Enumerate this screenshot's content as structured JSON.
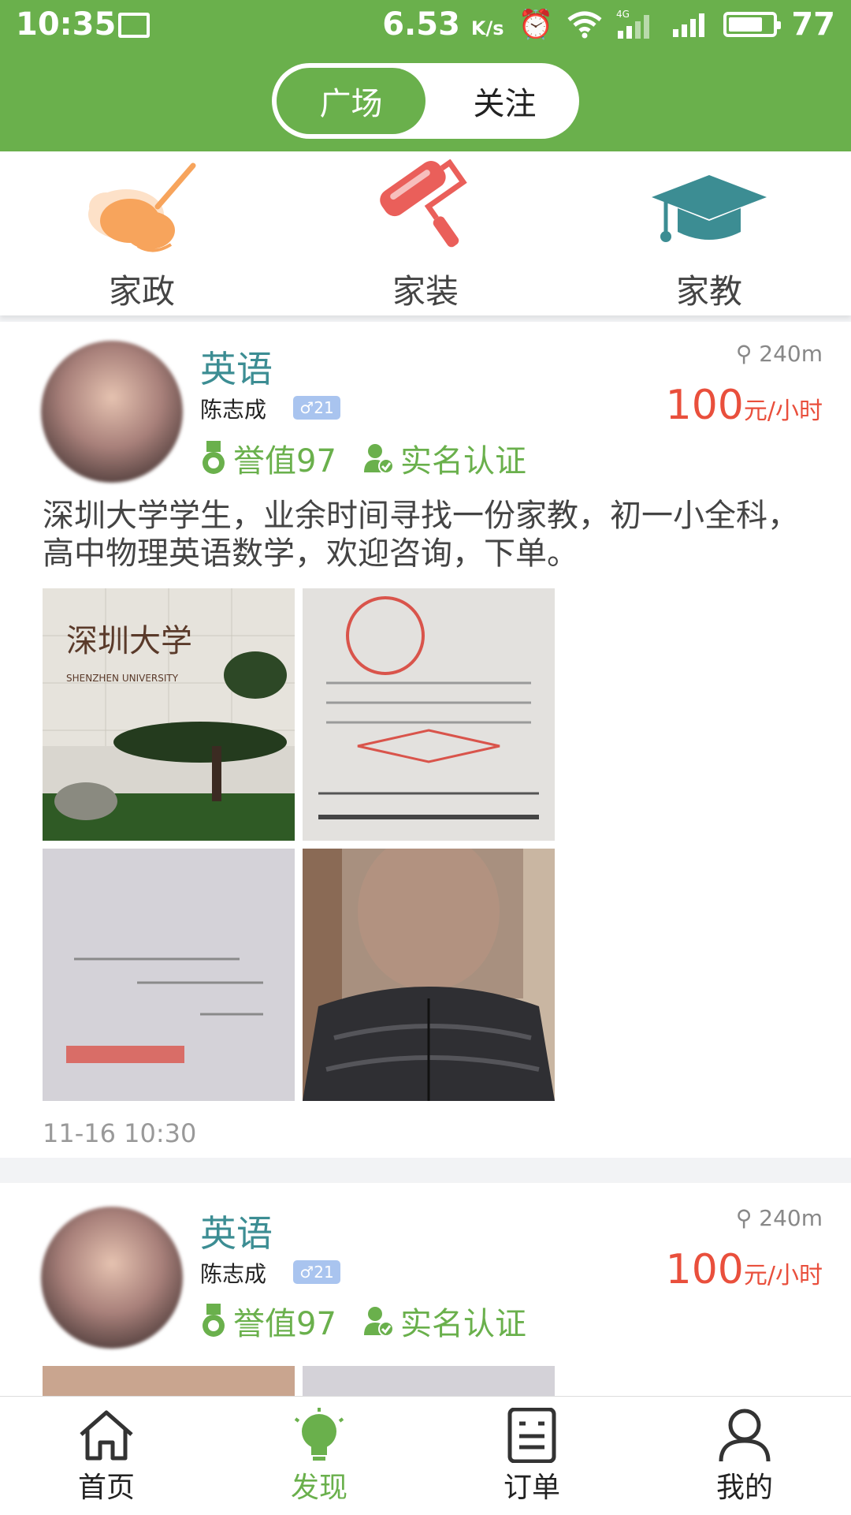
{
  "status_bar": {
    "time": "10:35",
    "net_speed": "6.53",
    "net_unit": "K/s",
    "network": "4G",
    "battery": "77"
  },
  "segment": {
    "active": "广场",
    "inactive": "关注"
  },
  "categories": [
    {
      "label": "家政",
      "icon": "broom-icon"
    },
    {
      "label": "家装",
      "icon": "paint-roller-icon"
    },
    {
      "label": "家教",
      "icon": "graduation-cap-icon"
    }
  ],
  "posts": [
    {
      "subject": "英语",
      "name": "陈志成",
      "gender_age": "♂21",
      "distance": "240m",
      "price_value": "100",
      "price_unit": "元/小时",
      "reputation": "誉值97",
      "verified": "实名认证",
      "description": "深圳大学学生，业余时间寻找一份家教，初一小全科，高中物理英语数学，欢迎咨询，下单。",
      "photo_caption_en": "SHENZHEN UNIVERSITY",
      "photo_caption_cn": "深圳大学",
      "timestamp": "11-16 10:30"
    },
    {
      "subject": "英语",
      "name": "陈志成",
      "gender_age": "♂21",
      "distance": "240m",
      "price_value": "100",
      "price_unit": "元/小时",
      "reputation": "誉值97",
      "verified": "实名认证"
    }
  ],
  "tabs": [
    {
      "label": "首页",
      "icon": "home-icon"
    },
    {
      "label": "发现",
      "icon": "lightbulb-icon",
      "active": true
    },
    {
      "label": "订单",
      "icon": "order-icon"
    },
    {
      "label": "我的",
      "icon": "person-icon"
    }
  ],
  "colors": {
    "brand_green": "#6ab04c",
    "subject_teal": "#3c8d93",
    "price_red": "#e94f3c",
    "gender_blue": "#a9c4ef"
  }
}
